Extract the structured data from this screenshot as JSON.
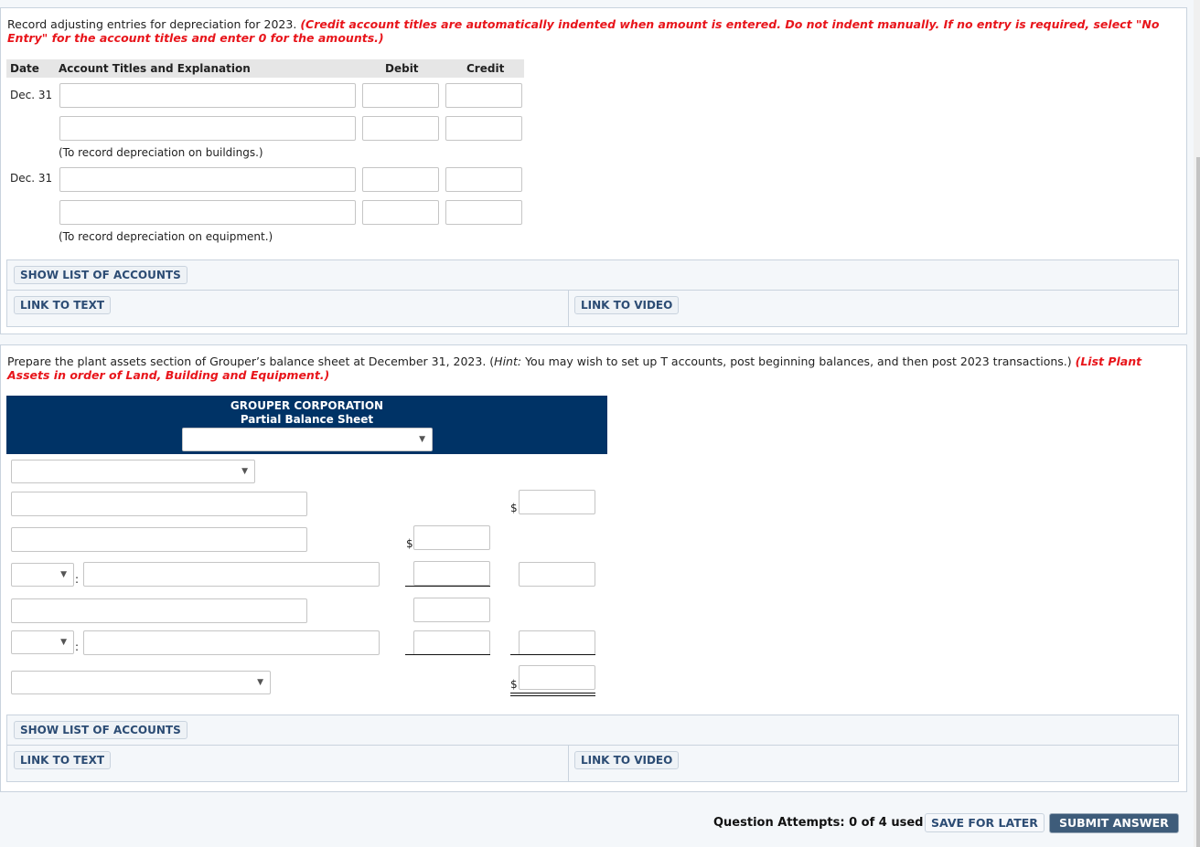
{
  "journal": {
    "instruction": "Record adjusting entries for depreciation for 2023.",
    "instruction_red": "(Credit account titles are automatically indented when amount is entered. Do not indent manually. If no entry is required, select \"No Entry\" for the account titles and enter 0 for the amounts.)",
    "headers": {
      "date": "Date",
      "account": "Account Titles and Explanation",
      "debit": "Debit",
      "credit": "Credit"
    },
    "entries": [
      {
        "date": "Dec. 31",
        "rows": [
          {
            "account": "",
            "debit": "",
            "credit": ""
          },
          {
            "account": "",
            "debit": "",
            "credit": ""
          }
        ],
        "explanation": "(To record depreciation on buildings.)"
      },
      {
        "date": "Dec. 31",
        "rows": [
          {
            "account": "",
            "debit": "",
            "credit": ""
          },
          {
            "account": "",
            "debit": "",
            "credit": ""
          }
        ],
        "explanation": "(To record depreciation on equipment.)"
      }
    ]
  },
  "links1": {
    "show_accounts": "SHOW LIST OF ACCOUNTS",
    "link_text": "LINK TO TEXT",
    "link_video": "LINK TO VIDEO"
  },
  "balance": {
    "instruction_a": "Prepare the plant assets section of Grouper’s balance sheet at December 31, 2023. (",
    "hint_label": "Hint:",
    "instruction_b": " You may wish to set up T accounts, post beginning balances, and then post 2023 transactions.) ",
    "instruction_red": "(List Plant Assets in order of Land, Building and Equipment.)",
    "company": "GROUPER CORPORATION",
    "statement": "Partial Balance Sheet",
    "date_select": "",
    "section_select": "",
    "currency": "$",
    "colon": ":",
    "total_select": ""
  },
  "links2": {
    "show_accounts": "SHOW LIST OF ACCOUNTS",
    "link_text": "LINK TO TEXT",
    "link_video": "LINK TO VIDEO"
  },
  "footer": {
    "attempts": "Question Attempts: 0 of 4 used",
    "save": "SAVE FOR LATER",
    "submit": "SUBMIT ANSWER"
  },
  "icons": {
    "dropdown": "▼"
  }
}
